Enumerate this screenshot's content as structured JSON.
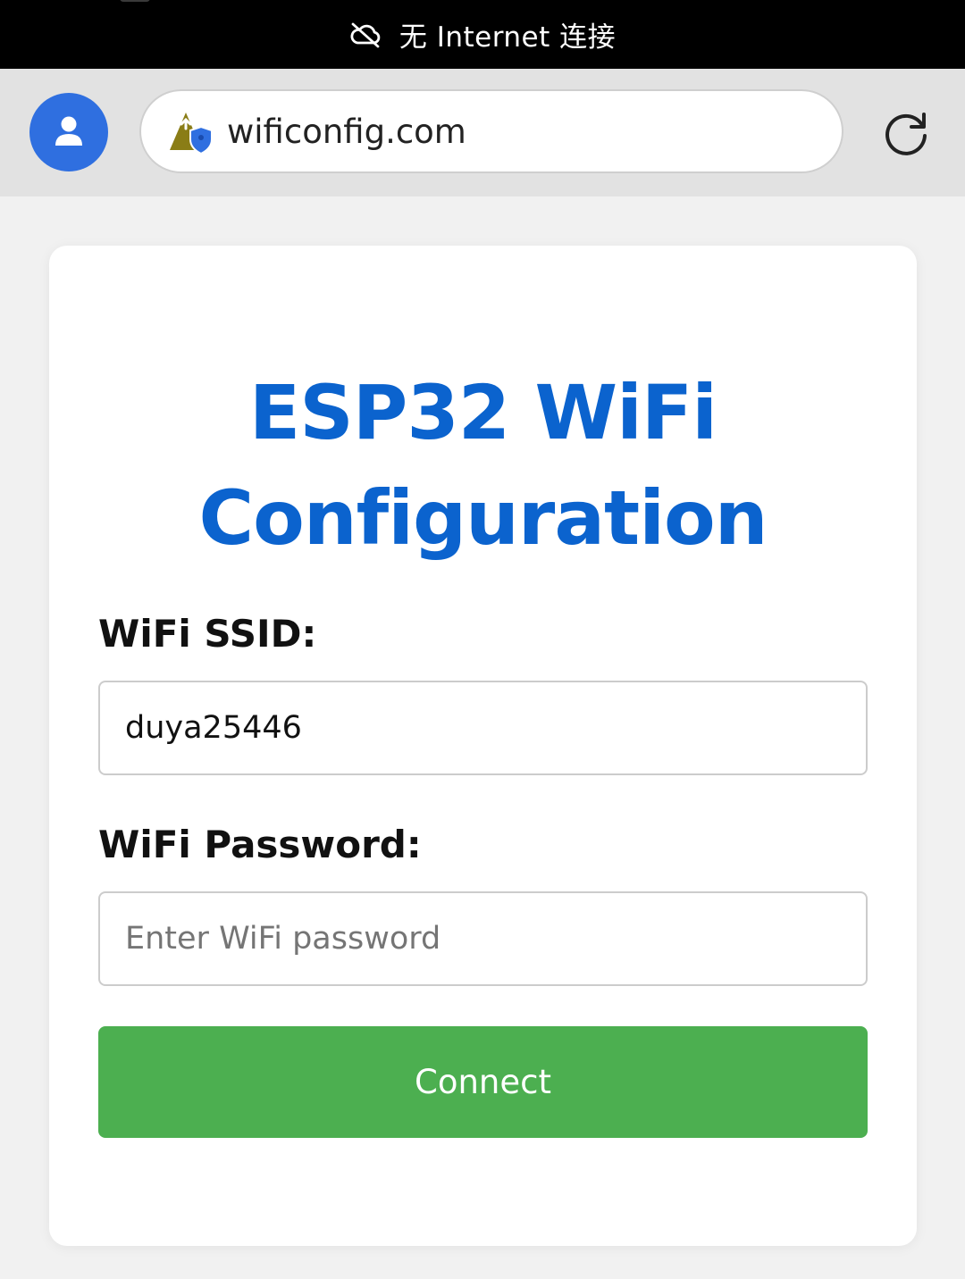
{
  "status_bar": {
    "text": "无 Internet 连接",
    "icon": "cloud-off-icon"
  },
  "browser": {
    "url": "wificonfig.com",
    "profile_icon": "user-avatar-icon",
    "site_icon": "site-security-icon",
    "reload_icon": "reload-icon"
  },
  "page": {
    "title": "ESP32 WiFi Configuration",
    "ssid_label": "WiFi SSID:",
    "ssid_value": "duya25446",
    "password_label": "WiFi Password:",
    "password_placeholder": "Enter WiFi password",
    "connect_label": "Connect"
  },
  "colors": {
    "accent_blue": "#0b63ce",
    "avatar_blue": "#2f6fe0",
    "button_green": "#4caf50",
    "status_bar_bg": "#000000"
  }
}
